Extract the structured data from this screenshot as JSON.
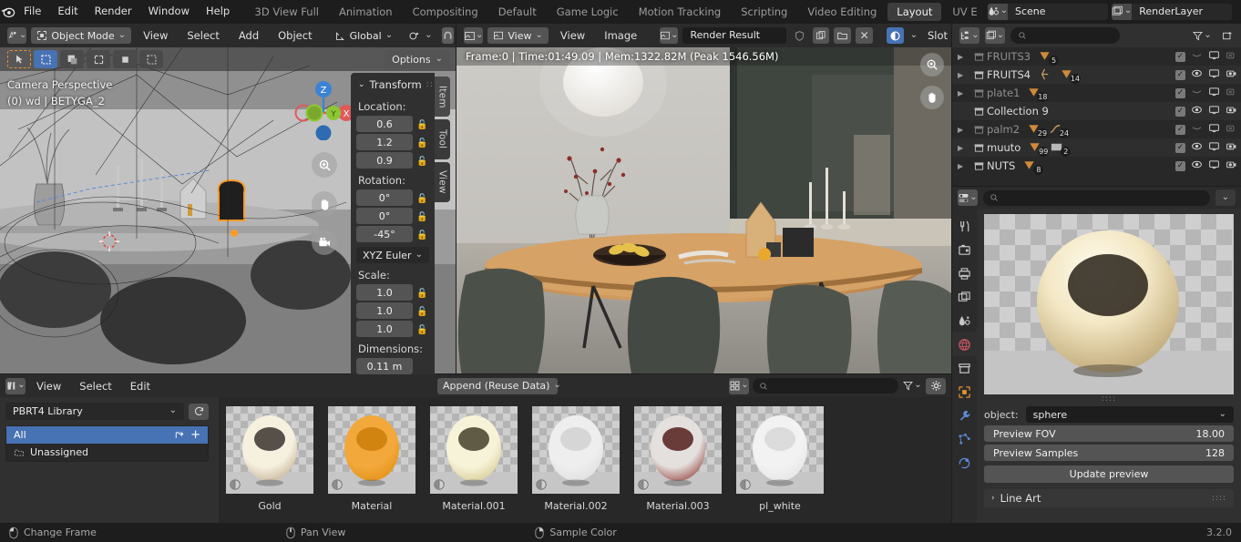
{
  "topbar": {
    "logo_icon": "blender-logo",
    "menus": [
      "File",
      "Edit",
      "Render",
      "Window",
      "Help"
    ],
    "workspaces": [
      {
        "label": "3D View Full",
        "active": false
      },
      {
        "label": "Animation",
        "active": false
      },
      {
        "label": "Compositing",
        "active": false
      },
      {
        "label": "Default",
        "active": false
      },
      {
        "label": "Game Logic",
        "active": false
      },
      {
        "label": "Motion Tracking",
        "active": false
      },
      {
        "label": "Scripting",
        "active": false
      },
      {
        "label": "Video Editing",
        "active": false
      },
      {
        "label": "Layout",
        "active": true
      },
      {
        "label": "UV E",
        "active": false
      }
    ],
    "scene": {
      "name": "Scene",
      "icon": "scene-icon",
      "copy_icon": "duplicate-icon",
      "close_icon": "x-icon"
    },
    "viewlayer": {
      "name": "RenderLayer",
      "icon": "renderlayer-icon",
      "copy_icon": "duplicate-icon",
      "close_icon": "x-icon"
    }
  },
  "viewport_header": {
    "editor_icon": "editor-type-3dview-icon",
    "mode": "Object Mode",
    "menus": [
      "View",
      "Select",
      "Add",
      "Object"
    ],
    "orientation": "Global",
    "pivot_icon": "pivot-icon",
    "snap_icon": "magnet-icon",
    "proportional_icon": "proportional-edit-icon"
  },
  "viewport": {
    "overlay_line1": "Camera Perspective",
    "overlay_line2": "(0) wd | BETYGA_2",
    "options_label": "Options",
    "gizmo_axes": [
      "Z",
      "Y",
      "X"
    ],
    "nav_icons": [
      "zoom-icon",
      "pan-hand-icon",
      "camera-view-icon"
    ],
    "tool_icons": [
      "cursor-icon",
      "tweak-select-box-icon",
      "select-box-icon",
      "select-circle-icon",
      "select-lasso-icon",
      "select-extend-icon"
    ]
  },
  "npanel": {
    "title": "Transform",
    "location_label": "Location:",
    "location": [
      "0.6",
      "1.2",
      "0.9"
    ],
    "rotation_label": "Rotation:",
    "rotation": [
      "0°",
      "0°",
      "-45°"
    ],
    "rotation_mode": "XYZ Euler",
    "scale_label": "Scale:",
    "scale": [
      "1.0",
      "1.0",
      "1.0"
    ],
    "dimensions_label": "Dimensions:",
    "dimensions_first": "0.11 m",
    "tabs": [
      {
        "label": "Item",
        "active": true
      },
      {
        "label": "Tool",
        "active": false
      },
      {
        "label": "View",
        "active": false
      }
    ]
  },
  "image_editor_header": {
    "editor_icon": "editor-type-image-icon",
    "mode": "View",
    "menus": [
      "View",
      "Image"
    ],
    "image_icon": "image-datablock-icon",
    "image_name": "Render Result",
    "buttons": [
      "shield-icon",
      "duplicate-icon",
      "folder-icon",
      "x-icon"
    ],
    "render_engine_icon": "cycles-icon",
    "slot_label": "Slot"
  },
  "render_stats": "Frame:0 | Time:01:49.09 | Mem:1322.82M (Peak 1546.56M)",
  "outliner_header": {
    "display_mode_icon": "outliner-display-mode-icon",
    "filter_id_icon": "filter-id-icon",
    "search_placeholder": "",
    "filter_icon": "funnel-icon",
    "new_collection_icon": "new-collection-icon"
  },
  "outliner": {
    "rows": [
      {
        "name": "FRUITS3",
        "dim": true,
        "expandable": true,
        "badges": [
          {
            "icon": "mesh-data-icon",
            "count": "5"
          }
        ],
        "visible": false
      },
      {
        "name": "FRUITS4",
        "dim": false,
        "expandable": true,
        "badges": [
          {
            "icon": "armature-icon",
            "count": ""
          },
          {
            "icon": "mesh-data-icon",
            "count": "14"
          }
        ],
        "visible": true
      },
      {
        "name": "plate1",
        "dim": true,
        "expandable": true,
        "badges": [
          {
            "icon": "mesh-data-icon",
            "count": "18"
          }
        ],
        "visible": false
      },
      {
        "name": "Collection 9",
        "dim": false,
        "expandable": false,
        "badges": [],
        "visible": true
      },
      {
        "name": "palm2",
        "dim": true,
        "expandable": true,
        "badges": [
          {
            "icon": "mesh-data-icon",
            "count": "29"
          },
          {
            "icon": "curve-icon",
            "count": "24"
          }
        ],
        "visible": false
      },
      {
        "name": "muuto",
        "dim": false,
        "expandable": true,
        "badges": [
          {
            "icon": "mesh-data-icon",
            "count": "99"
          },
          {
            "icon": "image-icon",
            "count": "2"
          }
        ],
        "visible": true
      },
      {
        "name": "NUTS",
        "dim": false,
        "expandable": true,
        "badges": [
          {
            "icon": "mesh-data-icon",
            "count": "8"
          }
        ],
        "visible": true
      }
    ],
    "toggle_icons": [
      "checkbox-icon",
      "eye-icon",
      "monitor-icon",
      "camera-icon"
    ]
  },
  "properties": {
    "header": {
      "editor_icon": "properties-editor-icon",
      "search_placeholder": "",
      "chevron_icon": "chevron-down-icon"
    },
    "tabs": [
      {
        "name": "tool-tab",
        "icon": "tool-icon",
        "active": false
      },
      {
        "name": "render-tab",
        "icon": "camera-back-icon",
        "active": false
      },
      {
        "name": "output-tab",
        "icon": "printer-icon",
        "active": false
      },
      {
        "name": "view-layer-tab",
        "icon": "images-icon",
        "active": false
      },
      {
        "name": "scene-tab",
        "icon": "scene-icon",
        "active": false
      },
      {
        "name": "world-tab",
        "icon": "world-icon",
        "active": true
      },
      {
        "name": "collection-tab",
        "icon": "box-icon",
        "active": false
      },
      {
        "name": "object-tab",
        "icon": "object-square-icon",
        "active": false
      },
      {
        "name": "modifier-tab",
        "icon": "wrench-icon",
        "active": false
      },
      {
        "name": "particles-tab",
        "icon": "particles-icon",
        "active": false
      },
      {
        "name": "physics-tab",
        "icon": "physics-icon",
        "active": false
      }
    ],
    "preview_name": "material-preview-sphere",
    "object_label": "object:",
    "object_value": "sphere",
    "preview_fov_label": "Preview FOV",
    "preview_fov_value": "18.00",
    "preview_samples_label": "Preview Samples",
    "preview_samples_value": "128",
    "update_preview_label": "Update preview",
    "line_art_label": "Line Art"
  },
  "asset_browser": {
    "editor_icon": "editor-type-asset-browser-icon",
    "menus": [
      "View",
      "Select",
      "Edit"
    ],
    "import_method": "Append (Reuse Data)",
    "display_mode_icon": "grid-view-icon",
    "search_placeholder": "",
    "filter_icon": "funnel-icon",
    "settings_icon": "gear-icon",
    "library": "PBRT4 Library",
    "refresh_icon": "refresh-icon",
    "categories": [
      {
        "label": "All",
        "selected": true
      },
      {
        "label": "Unassigned",
        "selected": false
      }
    ],
    "assets": [
      {
        "label": "Gold",
        "color1": "#f6f0df",
        "color2": "#b9a789",
        "dark": "#2e2823"
      },
      {
        "label": "Material",
        "color1": "#f2a83a",
        "color2": "#e08c10",
        "dark": "#c97b08"
      },
      {
        "label": "Material.001",
        "color1": "#f7f3d8",
        "color2": "#cfc489",
        "dark": "#3a3420"
      },
      {
        "label": "Material.002",
        "color1": "#eeeeee",
        "color2": "#dcdcdc",
        "dark": "#cfcfcf"
      },
      {
        "label": "Material.003",
        "color1": "#e4e0de",
        "color2": "#8c3028",
        "dark": "#4a1310"
      },
      {
        "label": "pl_white",
        "color1": "#f2f2f2",
        "color2": "#e2e2e2",
        "dark": "#d6d6d6"
      }
    ]
  },
  "statusbar": {
    "items": [
      {
        "icon": "mouse-left-icon",
        "label": "Change Frame"
      },
      {
        "icon": "mouse-middle-icon",
        "label": "Pan View"
      },
      {
        "icon": "mouse-right-icon",
        "label": "Sample Color"
      }
    ],
    "version": "3.2.0"
  },
  "colors": {
    "accent_blue": "#4772b3",
    "accent_orange": "#e8922c",
    "axis_x": "#e05a5a",
    "axis_y": "#8cc832",
    "axis_z": "#3b82d4"
  }
}
